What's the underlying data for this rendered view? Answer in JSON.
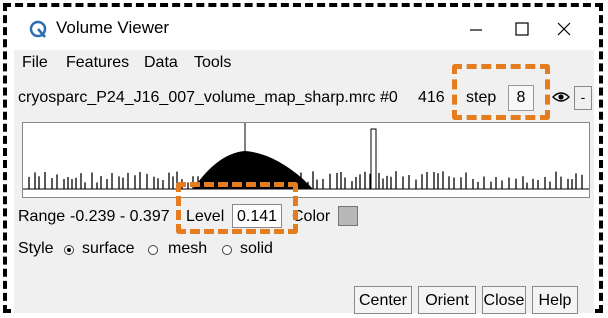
{
  "window": {
    "title": "Volume Viewer"
  },
  "menu": [
    "File",
    "Features",
    "Data",
    "Tools"
  ],
  "toolbar": {
    "filename": "cryosparc_P24_J16_007_volume_map_sharp.mrc #0",
    "size_value": "416",
    "step_label": "step",
    "step_value": "8",
    "collapse_label": "-"
  },
  "levels": {
    "range_label": "Range",
    "range_value": "-0.239 - 0.397",
    "level_label": "Level",
    "level_value": "0.141",
    "color_label": "Color"
  },
  "style": {
    "label": "Style",
    "options": [
      "surface",
      "mesh",
      "solid"
    ],
    "selected": "surface"
  },
  "buttons": [
    "Center",
    "Orient",
    "Close",
    "Help"
  ],
  "highlight_color": "#e57c1e"
}
